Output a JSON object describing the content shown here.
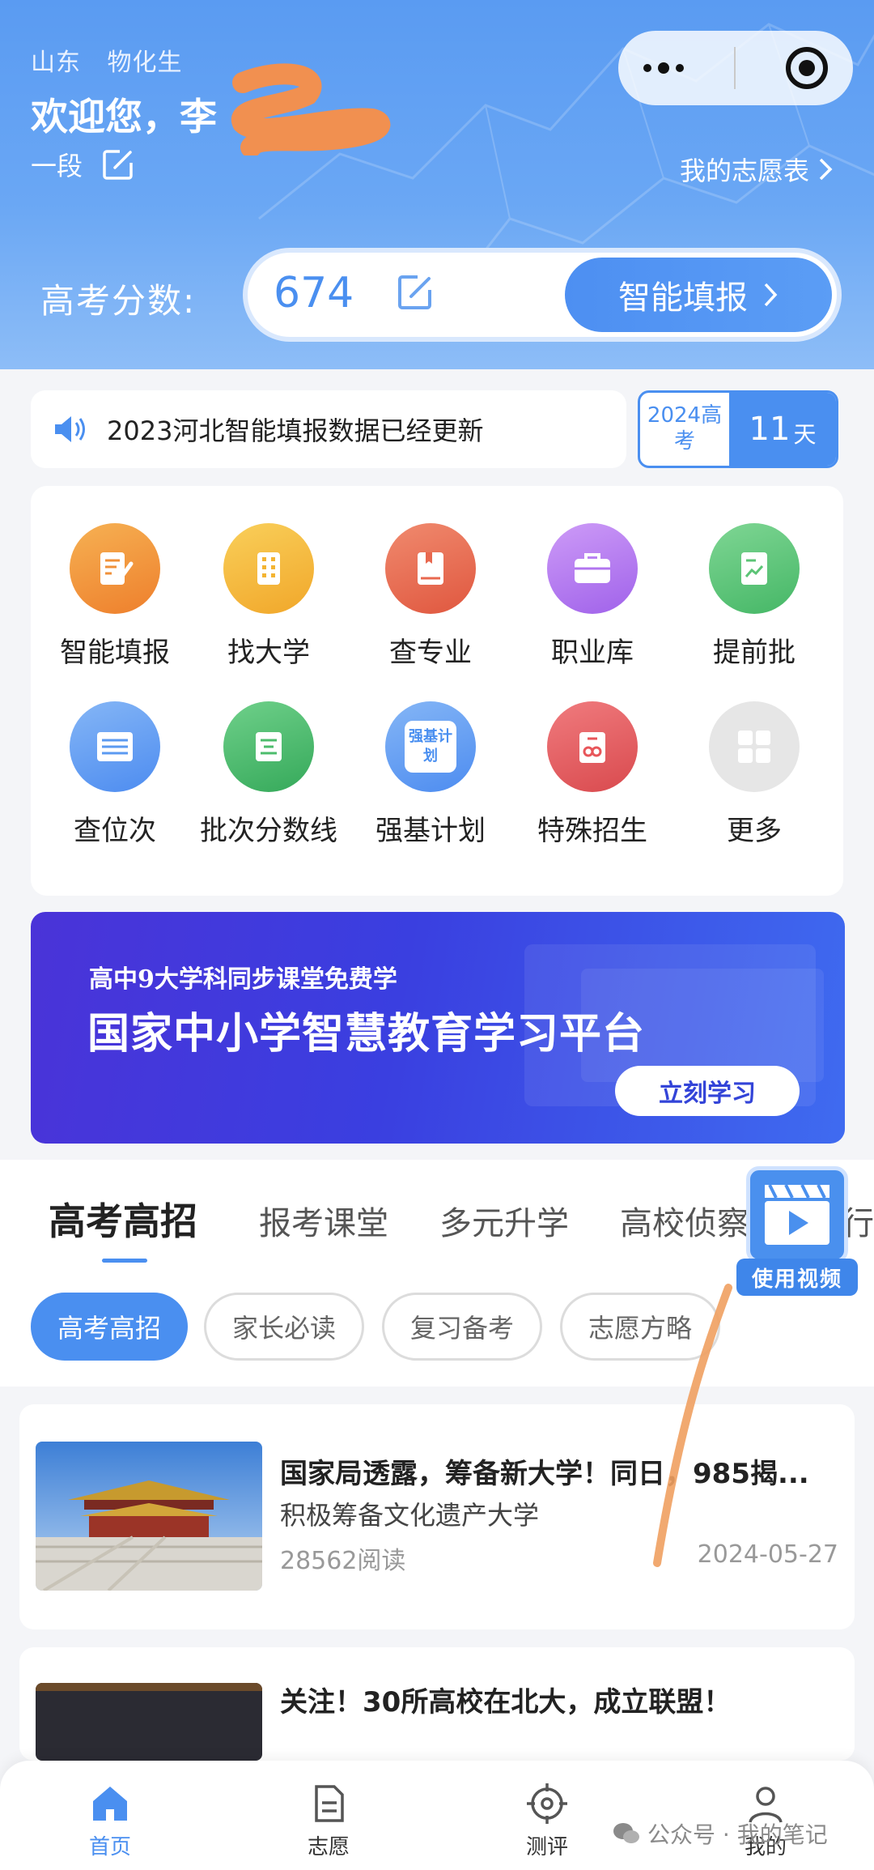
{
  "header": {
    "province": "山东",
    "subjects": "物化生",
    "welcome": "欢迎您，李",
    "level": "一段",
    "my_list": "我的志愿表",
    "score_label": "高考分数:",
    "score": "674",
    "smart_button": "智能填报"
  },
  "notice": {
    "text": "2023河北智能填报数据已经更新",
    "countdown_label": "2024高考",
    "countdown_days": "11",
    "countdown_unit": "天"
  },
  "grid": [
    {
      "label": "智能填报",
      "icon": "form-edit-icon",
      "color": "#f0913a"
    },
    {
      "label": "找大学",
      "icon": "building-icon",
      "color": "#f4b432"
    },
    {
      "label": "查专业",
      "icon": "book-icon",
      "color": "#e8684f"
    },
    {
      "label": "职业库",
      "icon": "briefcase-icon",
      "color": "#b274ef"
    },
    {
      "label": "提前批",
      "icon": "chart-doc-icon",
      "color": "#5cc476"
    },
    {
      "label": "查位次",
      "icon": "list-icon",
      "color": "#5b9af1"
    },
    {
      "label": "批次分数线",
      "icon": "lines-icon",
      "color": "#4cbc6c"
    },
    {
      "label": "强基计划",
      "icon": "qiangji-icon",
      "color": "#5b9af1",
      "icon_text": "强基计划"
    },
    {
      "label": "特殊招生",
      "icon": "special-icon",
      "color": "#e8565a"
    },
    {
      "label": "更多",
      "icon": "more-grid-icon",
      "color": "#d9d9d9"
    }
  ],
  "banner": {
    "subtitle": "高中9大学科同步课堂免费学",
    "title": "国家中小学智慧教育学习平台",
    "button": "立刻学习"
  },
  "tabs": [
    "高考高招",
    "报考课堂",
    "多元升学",
    "高校侦察兵",
    "行业"
  ],
  "chips": [
    "高考高招",
    "家长必读",
    "复习备考",
    "志愿方略"
  ],
  "video_label": "使用视频",
  "articles": [
    {
      "title": "国家局透露，筹备新大学！同日，985揭...",
      "desc": "积极筹备文化遗产大学",
      "reads": "28562阅读",
      "date": "2024-05-27"
    },
    {
      "title": "关注！30所高校在北大，成立联盟！"
    }
  ],
  "nav": [
    "首页",
    "志愿",
    "测评",
    "我的"
  ],
  "watermark": "公众号 · 我的笔记",
  "colors": {
    "primary": "#4a8ff0",
    "header": "#5a9bf2"
  }
}
